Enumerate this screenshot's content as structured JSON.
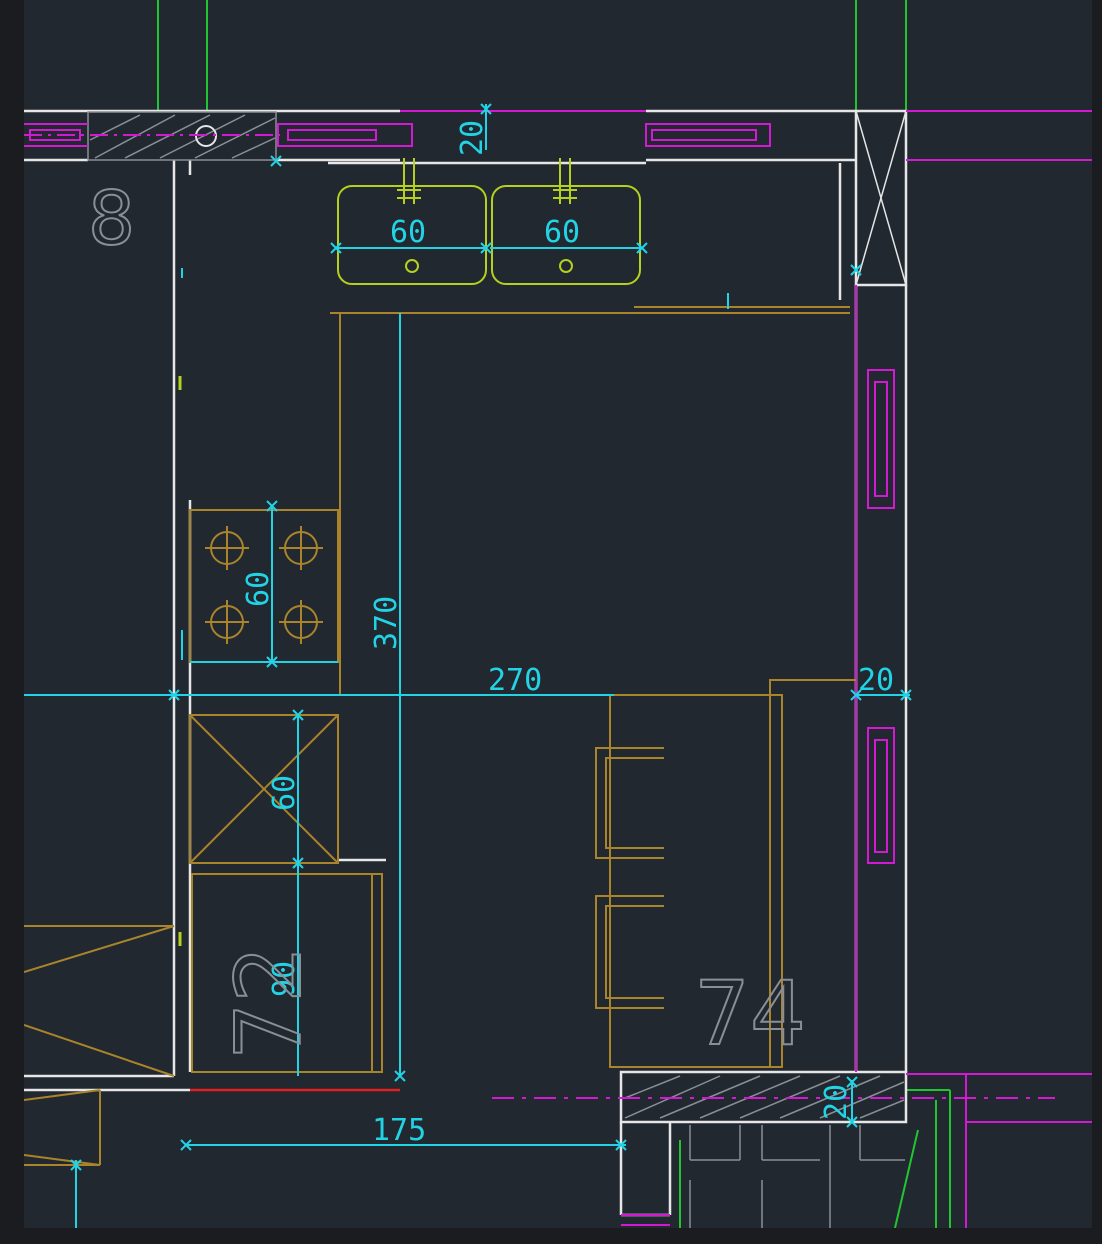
{
  "drawing": {
    "room_labels": {
      "room_8": "8",
      "room_72": "72",
      "room_74": "74"
    },
    "dimensions": {
      "sink_left_width": "60",
      "sink_right_width": "60",
      "wall_top_thickness": "20",
      "hob_depth": "60",
      "kitchen_length": "370",
      "kitchen_width": "270",
      "wall_right_thickness": "20",
      "oven_depth": "60",
      "cabinet_depth": "90",
      "corridor_width": "175",
      "wall_bottom_thickness": "20"
    },
    "colors": {
      "background": "#212830",
      "wall": "#e6e6e6",
      "dimension": "#22d3e6",
      "window": "#d21ad2",
      "furniture": "#a9842a",
      "sink": "#b5d11e",
      "pipe": "#22c531",
      "room_label": "#8a8f96",
      "threshold": "#e02020"
    }
  }
}
